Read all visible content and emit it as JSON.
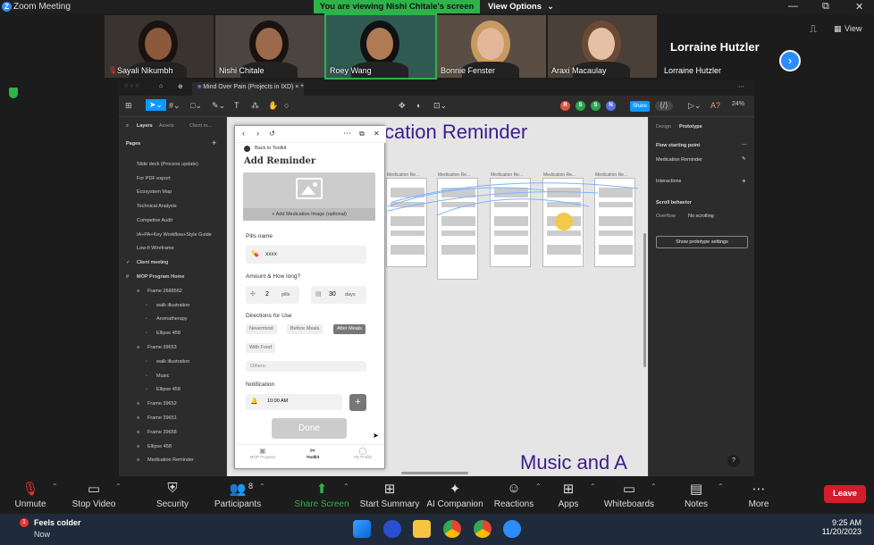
{
  "window": {
    "title": "Zoom Meeting",
    "banner": "You are viewing Nishi Chitale's screen",
    "view_options": "View Options",
    "view_label": "View"
  },
  "participants": [
    {
      "name": "Sayali Nikumbh",
      "muted": true
    },
    {
      "name": "Nishi Chitale",
      "muted": false
    },
    {
      "name": "Roey Wang",
      "muted": false,
      "speaking": true
    },
    {
      "name": "Bonnie Fenster",
      "muted": false
    },
    {
      "name": "Araxi Macaulay",
      "muted": false
    }
  ],
  "featured": {
    "big_name": "Lorraine Hutzler",
    "small_name": "Lorraine Hutzler"
  },
  "figma": {
    "tab_title": "Mind Over Pain (Projects in IXD)",
    "zoom": "24%",
    "share_label": "Share",
    "avatars": [
      {
        "letter": "R",
        "color": "#e5533c"
      },
      {
        "letter": "S",
        "color": "#2da44e"
      },
      {
        "letter": "S",
        "color": "#2da44e"
      },
      {
        "letter": "N",
        "color": "#5b6ee1"
      }
    ],
    "left_tabs": {
      "layers": "Layers",
      "assets": "Assets",
      "client": "Client m..."
    },
    "pages_label": "Pages",
    "pages": [
      "Slide deck (Process update)",
      "For PDF export",
      "Ecosystem Map",
      "Technical Analysis",
      "Competive Audit",
      "IA+PA+Key Workflow+Style Guide",
      "Low-fi Wireframe",
      "Client meeting"
    ],
    "layers": [
      {
        "label": "MOP Program Home",
        "indent": 0
      },
      {
        "label": "Frame 2688562",
        "indent": 1
      },
      {
        "label": "walk illustration",
        "indent": 2
      },
      {
        "label": "Aromatherapy",
        "indent": 2
      },
      {
        "label": "Ellipse 458",
        "indent": 2
      },
      {
        "label": "Frame 39653",
        "indent": 1
      },
      {
        "label": "walk illustration",
        "indent": 2
      },
      {
        "label": "Music",
        "indent": 2
      },
      {
        "label": "Ellipse 458",
        "indent": 2
      },
      {
        "label": "Frame 39652",
        "indent": 1
      },
      {
        "label": "Frame 39651",
        "indent": 1
      },
      {
        "label": "Frame 39658",
        "indent": 1
      },
      {
        "label": "Ellipse 458",
        "indent": 1
      },
      {
        "label": "Medication Reminder",
        "indent": 1
      }
    ],
    "canvas_title": "cation Reminder",
    "canvas_music": "Music and A",
    "frame_label": "Medication Re...",
    "right_tabs": {
      "design": "Design",
      "prototype": "Prototype"
    },
    "flow_label": "Flow starting point",
    "flow_item": "Medication Reminder",
    "interactions_label": "Interactions",
    "scroll_label": "Scroll behavior",
    "overflow_label": "Overflow",
    "overflow_value": "No scrolling",
    "proto_settings": "Show prototype settings",
    "help": "?"
  },
  "phone": {
    "back": "Back to Toolkit",
    "title": "Add Reminder",
    "add_image": "Add Medication Image (optional)",
    "pills_label": "Pills name",
    "pills_value": "xxxx",
    "amount_label": "Amount & How long?",
    "amount_value": "2",
    "amount_unit": "pills",
    "days_value": "30",
    "days_unit": "days",
    "directions_label": "Directions for Use",
    "directions": [
      {
        "label": "Nevermind",
        "selected": false
      },
      {
        "label": "Before Meals",
        "selected": false
      },
      {
        "label": "After Meals",
        "selected": true
      },
      {
        "label": "With Food",
        "selected": false
      }
    ],
    "others": "Others:",
    "notification_label": "Notification",
    "time": "10:00 AM",
    "done": "Done",
    "nav": [
      {
        "label": "MOP Program",
        "active": false
      },
      {
        "label": "Toolkit",
        "active": true
      },
      {
        "label": "My Profile",
        "active": false
      }
    ]
  },
  "controls": [
    {
      "label": "Unmute",
      "icon": "mic-muted-icon"
    },
    {
      "label": "Stop Video",
      "icon": "video-camera-icon"
    },
    {
      "label": "Security",
      "icon": "shield-icon"
    },
    {
      "label": "Participants",
      "icon": "participants-icon",
      "count": "8"
    },
    {
      "label": "Share Screen",
      "icon": "share-screen-icon"
    },
    {
      "label": "Start Summary",
      "icon": "summary-icon"
    },
    {
      "label": "AI Companion",
      "icon": "sparkle-icon"
    },
    {
      "label": "Reactions",
      "icon": "reactions-icon"
    },
    {
      "label": "Apps",
      "icon": "apps-icon"
    },
    {
      "label": "Whiteboards",
      "icon": "whiteboard-icon"
    },
    {
      "label": "Notes",
      "icon": "notes-icon"
    },
    {
      "label": "More",
      "icon": "more-icon"
    }
  ],
  "leave": "Leave",
  "taskbar": {
    "weather": "Feels colder",
    "weather_sub": "Now",
    "notif_count": "1",
    "time": "9:25 AM",
    "date": "11/20/2023"
  }
}
